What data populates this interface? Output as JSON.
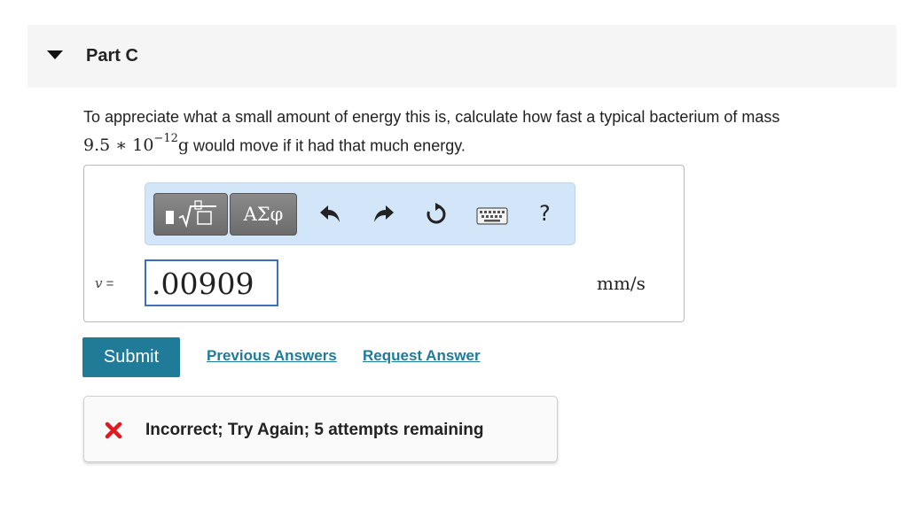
{
  "part": {
    "title": "Part C"
  },
  "question": {
    "text_before": "To appreciate what a small amount of energy this is, calculate how fast a typical bacterium of mass",
    "mass_mantissa": "9.5",
    "operator": "∗",
    "mass_base": "10",
    "mass_exponent": "−12",
    "mass_unit": "g",
    "text_after": "would move if it had that much energy."
  },
  "toolbar": {
    "template_icon": "radical-template-icon",
    "greek_label": "ΑΣφ",
    "undo_icon": "undo-icon",
    "redo_icon": "redo-icon",
    "reset_icon": "reset-icon",
    "keyboard_icon": "keyboard-icon",
    "help_label": "?"
  },
  "answer": {
    "variable": "v",
    "equals": "=",
    "value": ".00909",
    "unit": "mm/s"
  },
  "actions": {
    "submit_label": "Submit",
    "previous_answers_label": "Previous Answers",
    "request_answer_label": "Request Answer"
  },
  "feedback": {
    "icon": "incorrect-x-icon",
    "text": "Incorrect; Try Again; 5 attempts remaining"
  },
  "colors": {
    "submit_bg": "#1f7b97",
    "link": "#1d7b9c",
    "toolbar_bg": "#d3e6f9",
    "error_red": "#e0191f",
    "input_border": "#3d6fbd"
  }
}
